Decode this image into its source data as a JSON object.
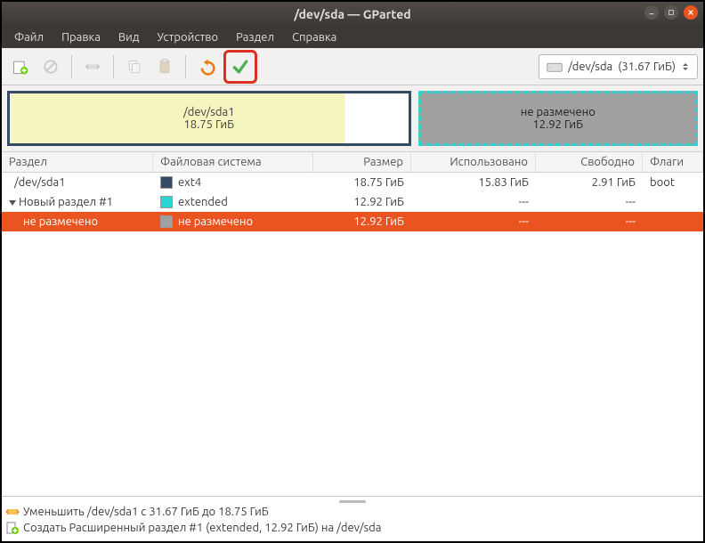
{
  "title": "/dev/sda — GParted",
  "menu": {
    "file": "Файл",
    "edit": "Правка",
    "view": "Вид",
    "device": "Устройство",
    "partition": "Раздел",
    "help": "Справка"
  },
  "device_selector": {
    "name": "/dev/sda",
    "size": "(31.67 ГиБ)"
  },
  "graphic": {
    "p1": {
      "name": "/dev/sda1",
      "size": "18.75 ГиБ"
    },
    "p2": {
      "name": "не размечено",
      "size": "12.92 ГиБ"
    }
  },
  "columns": {
    "part": "Раздел",
    "fs": "Файловая система",
    "size": "Размер",
    "used": "Использовано",
    "free": "Свободно",
    "flags": "Флаги"
  },
  "rows": [
    {
      "part": "/dev/sda1",
      "fs": "ext4",
      "size": "18.75 ГиБ",
      "used": "15.83 ГиБ",
      "free": "2.91 ГиБ",
      "flags": "boot"
    },
    {
      "part": "Новый раздел #1",
      "fs": "extended",
      "size": "12.92 ГиБ",
      "used": "---",
      "free": "---",
      "flags": ""
    },
    {
      "part": "не размечено",
      "fs": "не размечено",
      "size": "12.92 ГиБ",
      "used": "---",
      "free": "---",
      "flags": ""
    }
  ],
  "pending": [
    "Уменьшить /dev/sda1 с 31.67 ГиБ до 18.75 ГиБ",
    "Создать Расширенный раздел #1 (extended, 12.92 ГиБ) на /dev/sda"
  ]
}
